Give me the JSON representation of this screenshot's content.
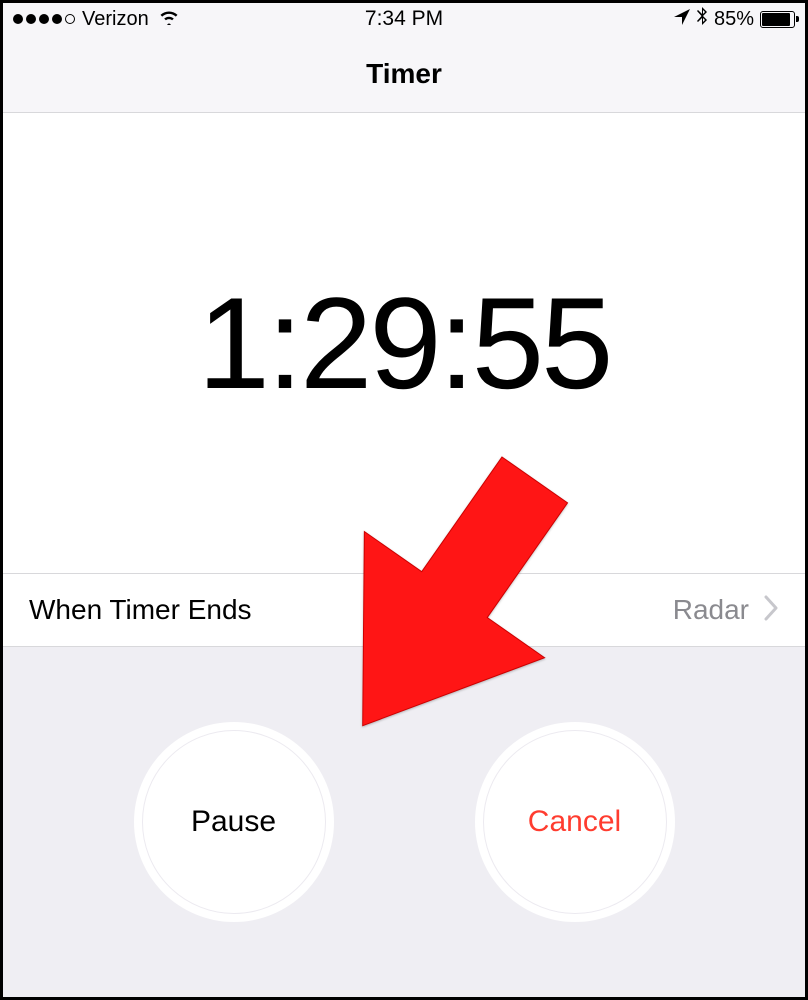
{
  "status": {
    "carrier": "Verizon",
    "time": "7:34 PM",
    "battery_pct": "85%"
  },
  "header": {
    "title": "Timer"
  },
  "timer": {
    "display": "1:29:55"
  },
  "ends_row": {
    "label": "When Timer Ends",
    "value": "Radar"
  },
  "buttons": {
    "pause": "Pause",
    "cancel": "Cancel"
  },
  "colors": {
    "cancel_red": "#ff3c2f",
    "arrow_red": "#ff1515"
  }
}
